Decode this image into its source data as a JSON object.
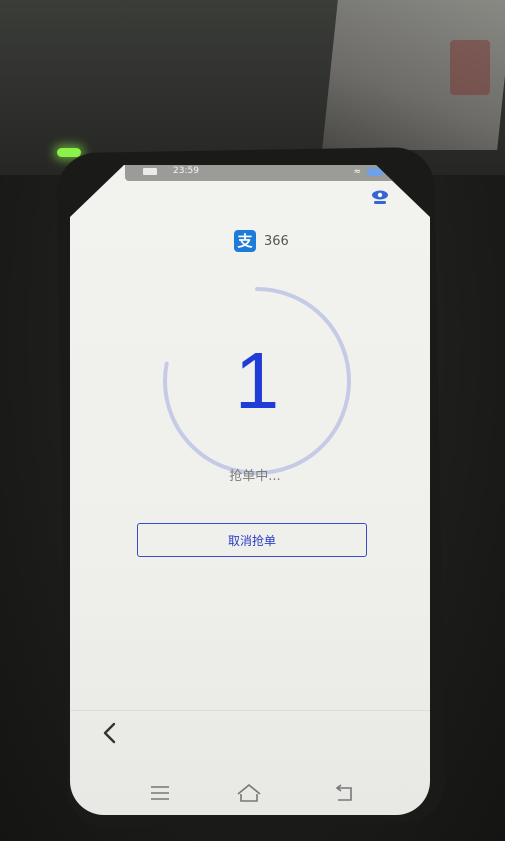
{
  "status_bar": {
    "time": "23:59"
  },
  "app_header": {
    "logo_char": "支",
    "code": "366"
  },
  "countdown": {
    "value": "1",
    "progress_fraction": 0.78
  },
  "status_text": "抢单中...",
  "cancel_button": {
    "label": "取消抢单"
  },
  "colors": {
    "accent": "#1f3cd6",
    "ring": "#c5cbe6",
    "alipay_blue": "#1e7bd9",
    "led_green": "#8cf24a"
  },
  "icons": {
    "back": "chevron-left-icon",
    "menu": "menu-icon",
    "home": "home-icon",
    "return": "return-icon",
    "accessibility": "accessibility-icon"
  }
}
